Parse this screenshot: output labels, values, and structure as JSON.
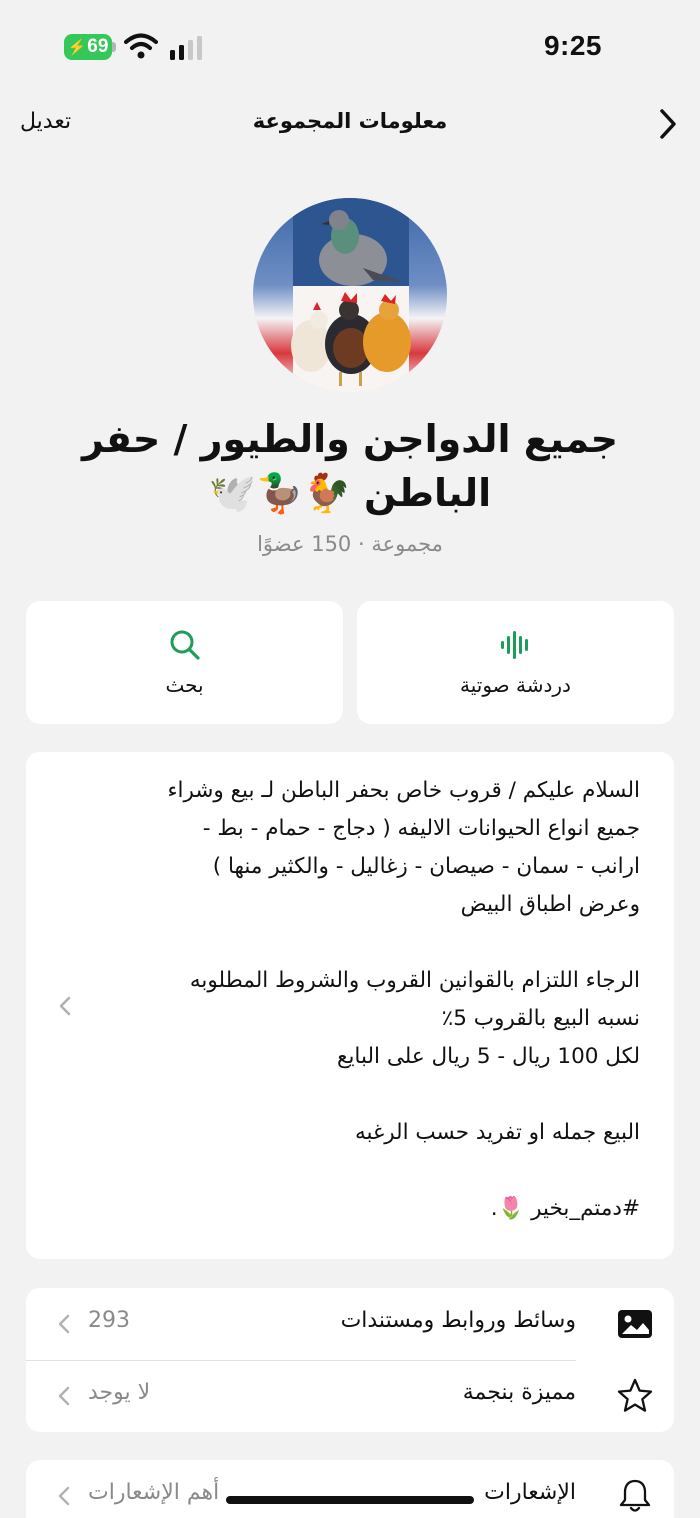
{
  "status": {
    "time": "9:25",
    "battery": "69",
    "icons": [
      "charging-bolt-icon",
      "wifi-icon",
      "signal-bars-icon"
    ]
  },
  "nav": {
    "edit_label": "تعديل",
    "title": "معلومات المجموعة",
    "back_icon": "chevron-right-icon"
  },
  "group": {
    "name": "جميع الدواجن والطيور / حفر الباطن 🐓🦆🕊️",
    "subtitle": "مجموعة · 150 عضوًا"
  },
  "actions": [
    {
      "label": "دردشة صوتية",
      "icon": "voice-waveform-icon"
    },
    {
      "label": "بحث",
      "icon": "search-icon"
    }
  ],
  "description": {
    "lines": [
      "السلام عليكم / قروب خاص بحفر الباطن لـ بيع وشراء",
      "جميع انواع الحيوانات الاليفه ( دجاج - حمام - بط -",
      "ارانب - سمان - صيصان - زغاليل - والكثير منها )",
      "وعرض اطباق البيض",
      "",
      "الرجاء اللتزام بالقوانين القروب والشروط المطلوبه",
      "نسبه البيع بالقروب 5٪",
      "لكل 100 ريال - 5 ريال على البايع",
      "",
      "البيع جمله او تفريد حسب الرغبه",
      "",
      "#دمتم_بخير 🌷."
    ]
  },
  "rows": [
    {
      "label": "وسائط وروابط ومستندات",
      "value": "293",
      "icon": "photo-icon"
    },
    {
      "label": "مميزة بنجمة",
      "value": "لا يوجد",
      "icon": "star-icon"
    },
    {
      "label": "الإشعارات",
      "value": "أهم الإشعارات",
      "icon": "bell-icon"
    }
  ],
  "colors": {
    "accent": "#1a9e5a",
    "background": "#f2f2f2",
    "battery": "#34c759",
    "secondary_text": "#8a8a8a"
  }
}
